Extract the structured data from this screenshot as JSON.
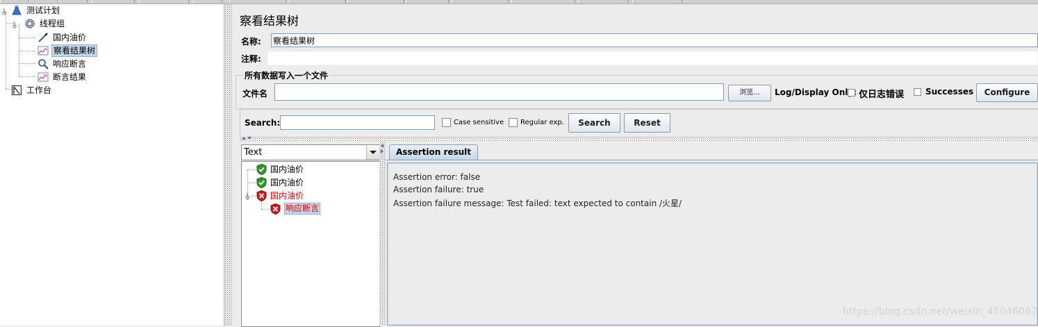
{
  "plan_tree": {
    "nodes": [
      {
        "label": "测试计划",
        "icon": "flask-icon"
      },
      {
        "label": "线程组",
        "icon": "gear-icon"
      },
      {
        "label": "国内油价",
        "icon": "pipette-icon"
      },
      {
        "label": "察看结果树",
        "icon": "chart-icon"
      },
      {
        "label": "响应断言",
        "icon": "magnifier-icon"
      },
      {
        "label": "断言结果",
        "icon": "chart-icon"
      },
      {
        "label": "工作台",
        "icon": "workbench-icon"
      }
    ],
    "selected": "察看结果树"
  },
  "panel": {
    "title": "察看结果树",
    "name_label": "名称:",
    "name_value": "察看结果树",
    "comment_label": "注释:",
    "comment_value": "",
    "file_group_title": "所有数据写入一个文件",
    "filename_label": "文件名",
    "filename_value": "",
    "browse_label": "浏览...",
    "log_display_label": "Log/Display Only:",
    "errors_only_label": "仅日志错误",
    "successes_label": "Successes",
    "configure_label": "Configure"
  },
  "search": {
    "label": "Search:",
    "value": "",
    "case_sensitive_label": "Case sensitive",
    "regex_label": "Regular exp.",
    "search_button": "Search",
    "reset_button": "Reset"
  },
  "results": {
    "renderer": "Text",
    "items": [
      {
        "label": "国内油价",
        "status": "pass"
      },
      {
        "label": "国内油价",
        "status": "pass"
      },
      {
        "label": "国内油价",
        "status": "fail"
      },
      {
        "label": "响应断言",
        "status": "fail"
      }
    ],
    "tab_label": "Assertion result",
    "assertion_lines": [
      "Assertion error: false",
      "Assertion failure: true",
      "Assertion failure message: Test failed: text expected to contain /火星/"
    ]
  },
  "colors": {
    "fail_text": "#e00000",
    "pass_green": "#2e9a2e",
    "fail_red": "#cc2020",
    "selection": "#c3d7ea"
  },
  "watermark": "https://blog.csdn.net/weixin_45046067"
}
